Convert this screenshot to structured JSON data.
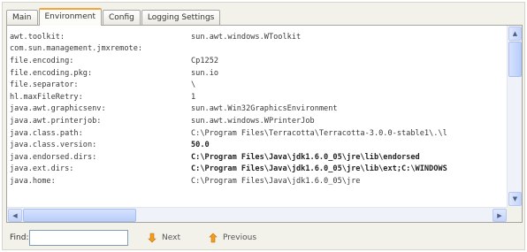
{
  "tabs": [
    {
      "label": "Main",
      "active": false
    },
    {
      "label": "Environment",
      "active": true
    },
    {
      "label": "Config",
      "active": false
    },
    {
      "label": "Logging Settings",
      "active": false
    }
  ],
  "properties": [
    {
      "key": "awt.toolkit:",
      "value": "sun.awt.windows.WToolkit"
    },
    {
      "key": "com.sun.management.jmxremote:",
      "value": ""
    },
    {
      "key": "file.encoding:",
      "value": "Cp1252"
    },
    {
      "key": "file.encoding.pkg:",
      "value": "sun.io"
    },
    {
      "key": "file.separator:",
      "value": "\\"
    },
    {
      "key": "hl.maxFileRetry:",
      "value": "1"
    },
    {
      "key": "java.awt.graphicsenv:",
      "value": "sun.awt.Win32GraphicsEnvironment"
    },
    {
      "key": "java.awt.printerjob:",
      "value": "sun.awt.windows.WPrinterJob"
    },
    {
      "key": "java.class.path:",
      "value": "C:\\Program Files\\Terracotta\\Terracotta-3.0.0-stable1\\.\\l"
    },
    {
      "key": "java.class.version:",
      "value": "50.0",
      "bold": true
    },
    {
      "key": "java.endorsed.dirs:",
      "value": "C:\\Program Files\\Java\\jdk1.6.0_05\\jre\\lib\\endorsed",
      "bold": true
    },
    {
      "key": "java.ext.dirs:",
      "value": "C:\\Program Files\\Java\\jdk1.6.0_05\\jre\\lib\\ext;C:\\WINDOWS",
      "bold": true
    },
    {
      "key": "java.home:",
      "value": "C:\\Program Files\\Java\\jdk1.6.0_05\\jre"
    }
  ],
  "find": {
    "label": "Find:",
    "value": "",
    "next_label": "Next",
    "previous_label": "Previous"
  },
  "icons": {
    "next": "arrow-down-orange-icon",
    "previous": "arrow-up-orange-icon",
    "scroll_up": "triangle-up-icon",
    "scroll_down": "triangle-down-icon",
    "scroll_left": "triangle-left-icon",
    "scroll_right": "triangle-right-icon"
  },
  "colors": {
    "active_tab_accent": "#f7a43a",
    "scrollbar": "#c3d3fb",
    "arrow_icon": "#f39c1f"
  }
}
